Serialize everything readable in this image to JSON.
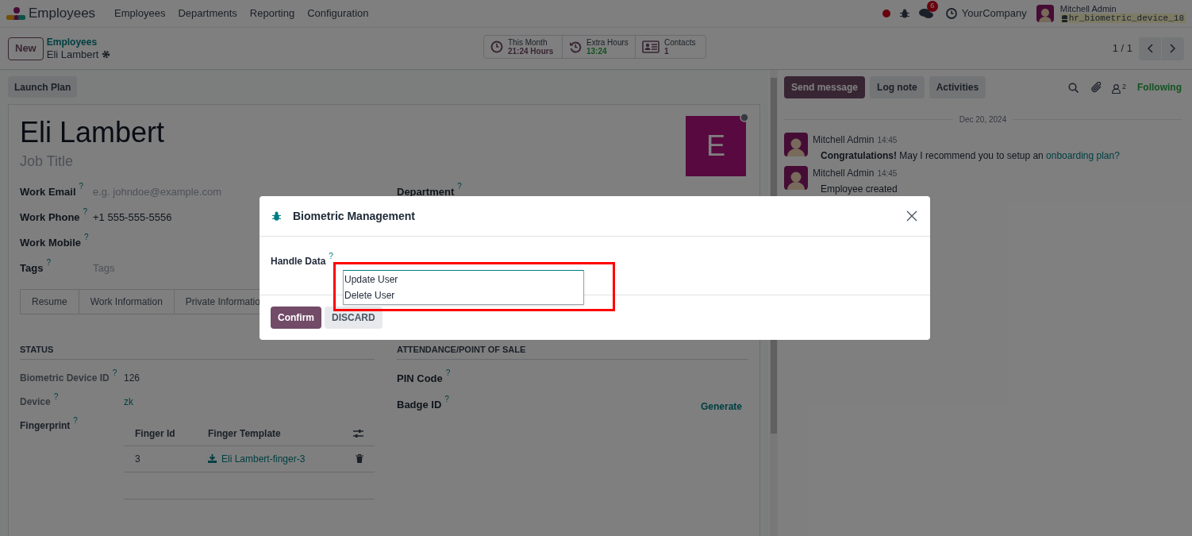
{
  "navbar": {
    "app_name": "Employees",
    "menu": [
      "Employees",
      "Departments",
      "Reporting",
      "Configuration"
    ],
    "chat_badge": "6",
    "company": "YourCompany",
    "user": "Mitchell Admin",
    "database": "hr_biometric_device_18"
  },
  "control_panel": {
    "new_button": "New",
    "breadcrumb": "Employees",
    "record": "Eli Lambert",
    "pager": "1 / 1",
    "stats": [
      {
        "kind": "clock",
        "label": "This Month",
        "value": "21:24 Hours"
      },
      {
        "kind": "history",
        "label": "Extra Hours",
        "value": "13:24"
      },
      {
        "kind": "card",
        "label": "Contacts",
        "value": "1"
      }
    ]
  },
  "form": {
    "actions": [
      "Launch Plan"
    ],
    "name": "Eli Lambert",
    "job_title_placeholder": "Job Title",
    "avatar_letter": "E",
    "fields": [
      {
        "label": "Work Email",
        "help": "?",
        "placeholder": "e.g. johndoe@example.com"
      },
      {
        "label": "Work Phone",
        "help": "?",
        "value": "+1 555-555-5556"
      },
      {
        "label": "Work Mobile",
        "help": "?"
      },
      {
        "label": "Tags",
        "help": "?",
        "placeholder": "Tags"
      }
    ],
    "right_fields": [
      {
        "label": "Department",
        "help": "?"
      }
    ],
    "tabs": [
      "Resume",
      "Work Information",
      "Private Informatio"
    ],
    "status": {
      "title": "STATUS",
      "fields": [
        {
          "label": "Biometric Device ID",
          "help": "?",
          "value": "126",
          "kind": "text"
        },
        {
          "label": "Device",
          "help": "?",
          "value": "zk",
          "kind": "link"
        }
      ],
      "fingerprint": {
        "label": "Fingerprint",
        "help": "?",
        "columns": [
          "Finger Id",
          "Finger Template"
        ],
        "rows": [
          {
            "finger_id": "3",
            "template": "Eli Lambert-finger-3"
          }
        ]
      }
    },
    "attendance": {
      "title": "ATTENDANCE/POINT OF SALE",
      "fields": [
        {
          "label": "PIN Code",
          "help": "?"
        },
        {
          "label": "Badge ID",
          "help": "?",
          "action": "Generate"
        }
      ]
    }
  },
  "chatter": {
    "buttons": [
      {
        "label": "Send message",
        "kind": "primary"
      },
      {
        "label": "Log note",
        "kind": "secondary"
      },
      {
        "label": "Activities",
        "kind": "secondary"
      }
    ],
    "followers": "2",
    "following": "Following",
    "date": "Dec 20, 2024",
    "messages": [
      {
        "author": "Mitchell Admin",
        "time": "14:45",
        "text": "**Congratulations!** May I recommend you to setup an ",
        "link": "onboarding plan?"
      },
      {
        "author": "Mitchell Admin",
        "time": "14:45",
        "text": "Employee created"
      }
    ]
  },
  "dialog": {
    "title": "Biometric Management",
    "field_label": "Handle Data",
    "help": "?",
    "options": [
      "Update User",
      "Delete User"
    ],
    "buttons": [
      {
        "label": "Confirm",
        "kind": "primary"
      },
      {
        "label": "DISCARD",
        "kind": "secondary"
      }
    ]
  }
}
